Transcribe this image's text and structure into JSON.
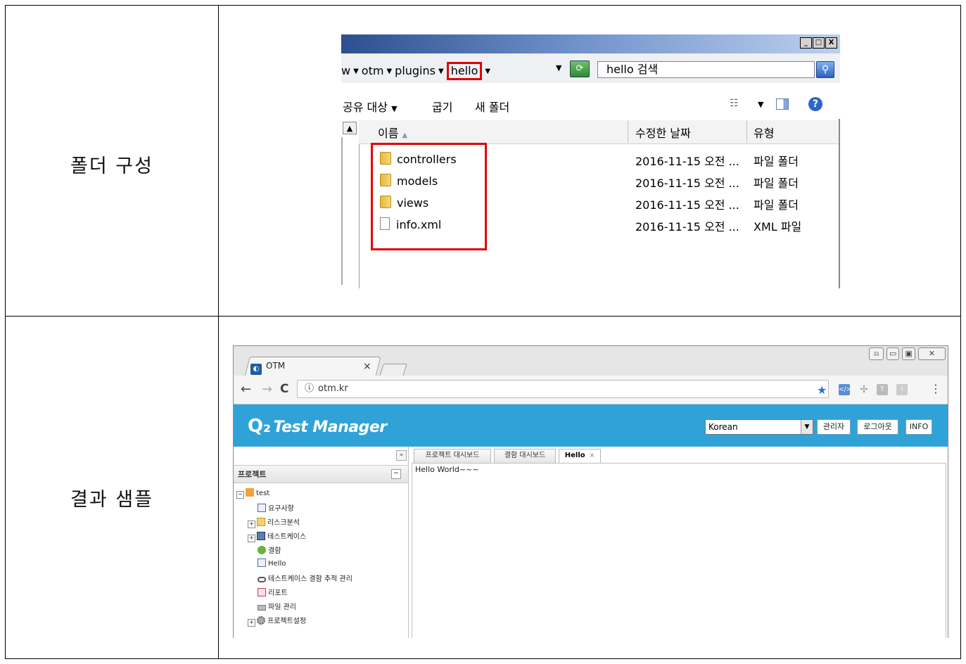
{
  "rows": [
    {
      "label": "폴더 구성"
    },
    {
      "label": "결과 샘플"
    }
  ],
  "explorer": {
    "window_buttons": [
      "_",
      "□",
      "X"
    ],
    "breadcrumb": [
      "w",
      "otm",
      "plugins",
      "hello"
    ],
    "search_value": "hello 검색",
    "toolbar": {
      "share": "공유 대상",
      "burn": "굽기",
      "new_folder": "새 폴더"
    },
    "columns": {
      "name": "이름",
      "modified": "수정한 날짜",
      "type": "유형"
    },
    "files": [
      {
        "name": "controllers",
        "date": "2016-11-15 오전 ...",
        "type": "파일 폴더",
        "icon": "folder-icon"
      },
      {
        "name": "models",
        "date": "2016-11-15 오전 ...",
        "type": "파일 폴더",
        "icon": "folder-icon"
      },
      {
        "name": "views",
        "date": "2016-11-15 오전 ...",
        "type": "파일 폴더",
        "icon": "folder-icon"
      },
      {
        "name": "info.xml",
        "date": "2016-11-15 오전 ...",
        "type": "XML 파일",
        "icon": "file-icon"
      }
    ],
    "highlight_color": "#e00000"
  },
  "browser": {
    "tab_title": "OTM",
    "tab_close": "×",
    "url": "otm.kr",
    "app_title": "Test Manager",
    "language": "Korean",
    "header_buttons": {
      "admin": "관리자",
      "logout": "로그아웃",
      "info": "INFO"
    },
    "collapse": "«",
    "panel_title": "프로젝트",
    "panel_min": "−",
    "tree": {
      "root": "test",
      "items": [
        "요구사항",
        "리스크분석",
        "테스트케이스",
        "결함",
        "Hello",
        "테스트케이스 결함 추적 관리",
        "리포트",
        "파일 관리",
        "프로젝트설정"
      ]
    },
    "page_tabs": {
      "project_dashboard": "프로젝트 대시보드",
      "defect_dashboard": "결함 대시보드",
      "hello": "Hello",
      "hello_close": "×"
    },
    "content_text": "Hello World~~~",
    "header_color": "#2fa3d8"
  }
}
